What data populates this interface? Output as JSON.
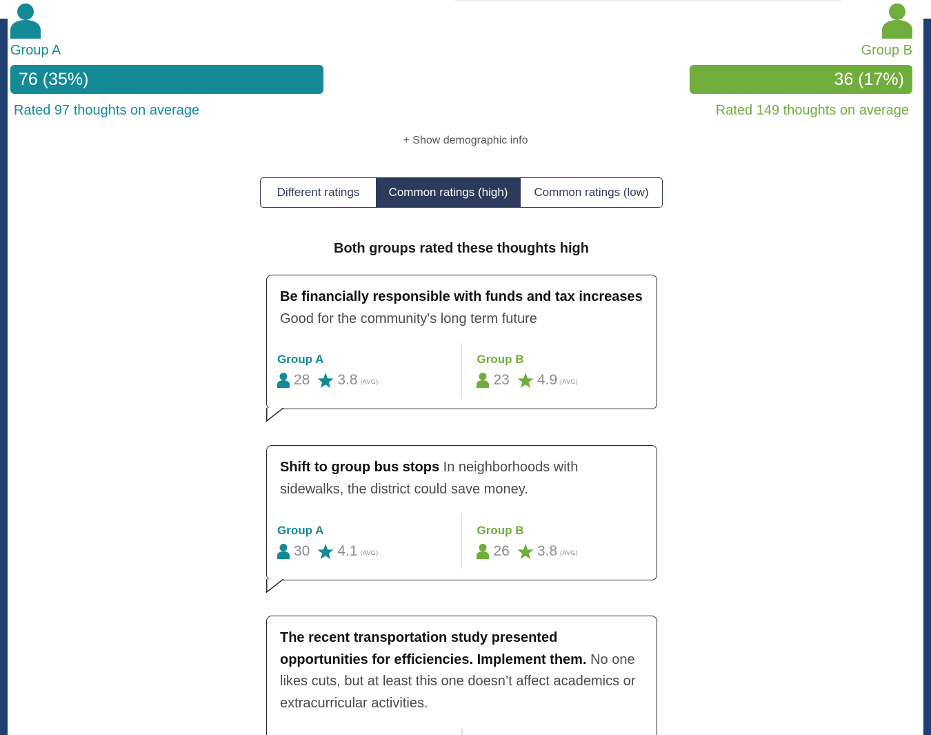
{
  "colors": {
    "group_a": "#138a96",
    "group_b": "#70ad3d",
    "navy": "#2c3a5c"
  },
  "groups": {
    "a": {
      "name": "Group A",
      "count_label": "76 (35%)",
      "rated": "Rated 97 thoughts on average",
      "icon": "person-icon"
    },
    "b": {
      "name": "Group B",
      "count_label": "36 (17%)",
      "rated": "Rated 149 thoughts on average",
      "icon": "person-icon"
    }
  },
  "show_demographic": "+ Show demographic info",
  "tabs": [
    {
      "label": "Different ratings",
      "active": false
    },
    {
      "label": "Common ratings (high)",
      "active": true
    },
    {
      "label": "Common ratings (low)",
      "active": false
    }
  ],
  "section_title": "Both groups rated these thoughts high",
  "cards": [
    {
      "title": "Be financially responsible with funds and tax increases",
      "body": "Good for the community's long term future",
      "group_a": {
        "name": "Group A",
        "count": "28",
        "rating": "3.8",
        "avg": "(AVG)"
      },
      "group_b": {
        "name": "Group B",
        "count": "23",
        "rating": "4.9",
        "avg": "(AVG)"
      }
    },
    {
      "title": "Shift to group bus stops",
      "body": "In neighborhoods with sidewalks, the district could save money.",
      "group_a": {
        "name": "Group A",
        "count": "30",
        "rating": "4.1",
        "avg": "(AVG)"
      },
      "group_b": {
        "name": "Group B",
        "count": "26",
        "rating": "3.8",
        "avg": "(AVG)"
      }
    },
    {
      "title": "The recent transportation study presented opportunities for efficiencies. Implement them.",
      "body": "No one likes cuts, but at least this one doesn’t affect academics or extracurricular activities."
    }
  ]
}
